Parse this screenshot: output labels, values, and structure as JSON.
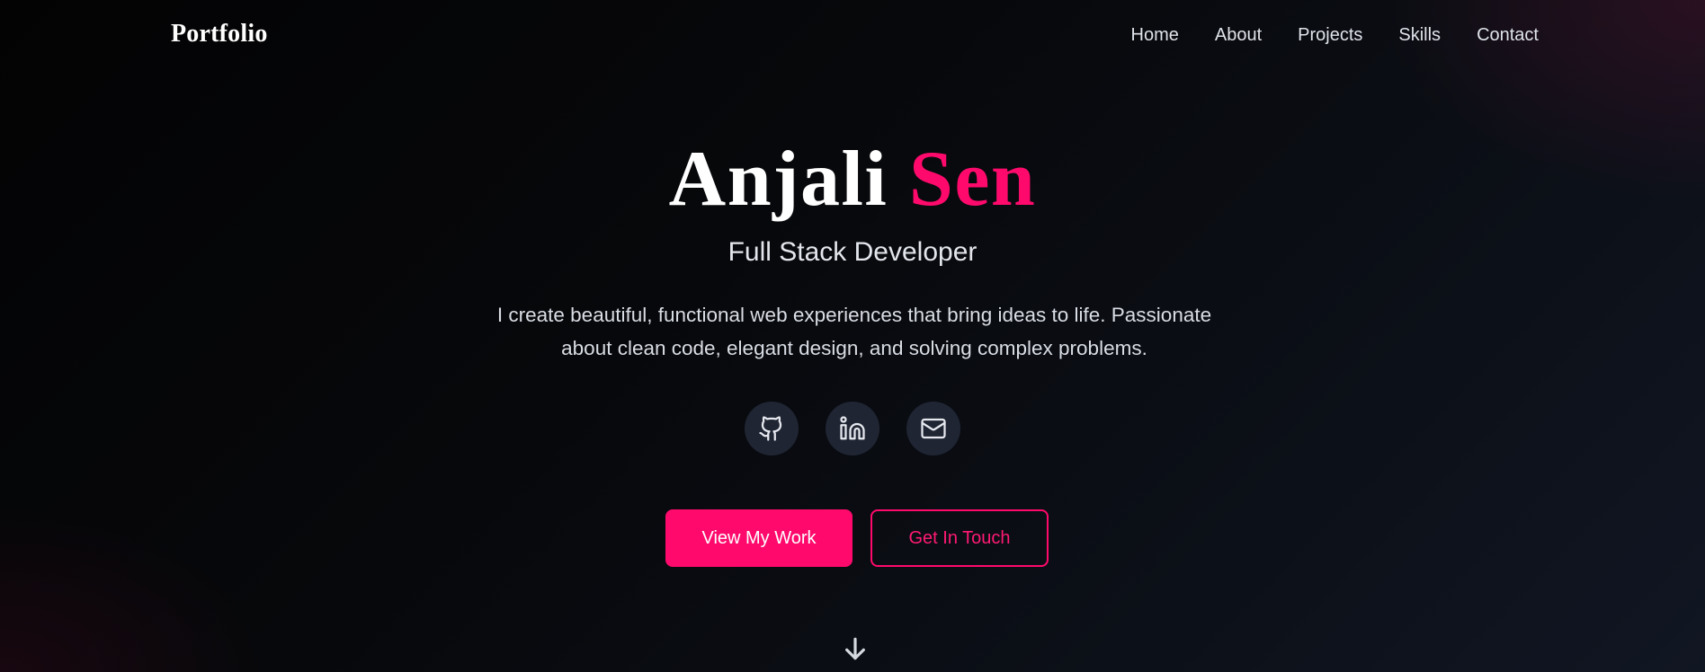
{
  "nav": {
    "brand": "Portfolio",
    "links": [
      {
        "label": "Home"
      },
      {
        "label": "About"
      },
      {
        "label": "Projects"
      },
      {
        "label": "Skills"
      },
      {
        "label": "Contact"
      }
    ]
  },
  "hero": {
    "first_name": "Anjali",
    "last_name": "Sen",
    "role": "Full Stack Developer",
    "bio": "I create beautiful, functional web experiences that bring ideas to life. Passionate about clean code, elegant design, and solving complex problems.",
    "socials": [
      {
        "icon": "github-icon"
      },
      {
        "icon": "linkedin-icon"
      },
      {
        "icon": "mail-icon"
      }
    ],
    "primary_button": "View My Work",
    "secondary_button": "Get In Touch",
    "scroll_icon": "arrow-down-icon"
  },
  "colors": {
    "accent": "#ff0a6c",
    "background": "#07080b",
    "icon_bg": "#1f2533"
  }
}
